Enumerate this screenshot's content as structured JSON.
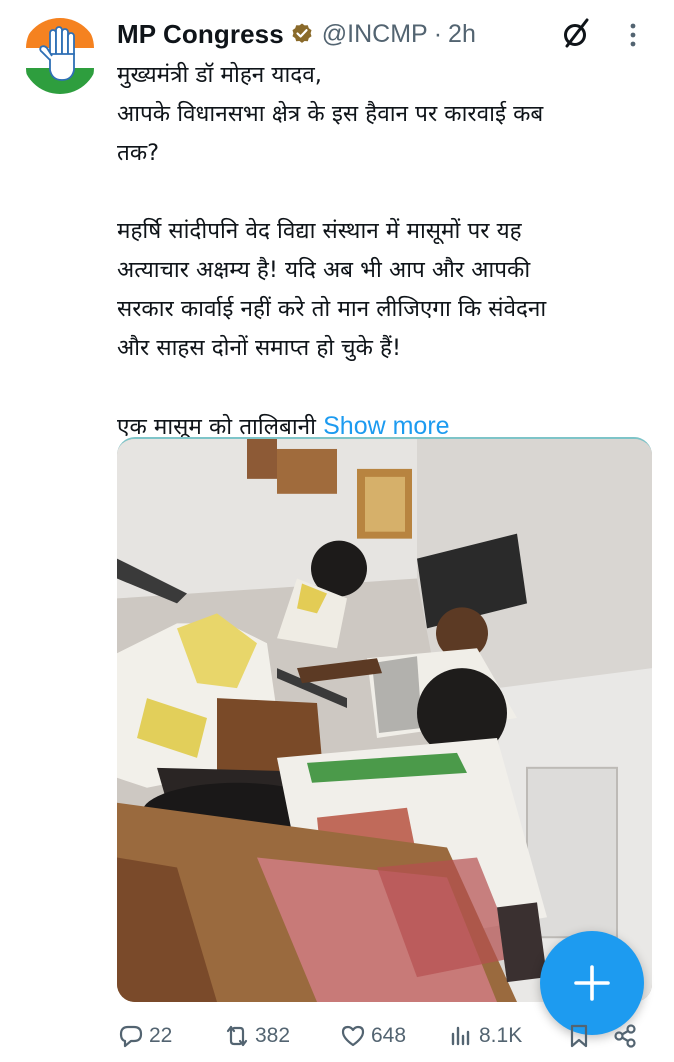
{
  "tweet": {
    "display_name": "MP Congress",
    "handle": "@INCMP",
    "separator": "·",
    "time": "2h",
    "body": {
      "line1": "मुख्यमंत्री डॉ मोहन यादव,",
      "line2": "आपके विधानसभा क्षेत्र के इस हैवान पर कारवाई कब",
      "line3": "तक?",
      "para2_line1": "महर्षि सांदीपनि वेद विद्या संस्थान में मासूमों पर यह",
      "para2_line2": "अत्याचार अक्षम्य है! यदि अब भी आप और आपकी",
      "para2_line3": "सरकार कार्वाई नहीं करे तो मान लीजिएगा कि संवेदना",
      "para2_line4": "और साहस दोनों समाप्त हो चुके हैं!",
      "para3": "एक मासूम को तालिबानी",
      "show_more": "Show more"
    },
    "stats": {
      "replies": "22",
      "reposts": "382",
      "likes": "648",
      "views": "8.1K"
    }
  },
  "colors": {
    "accent": "#1d9bf0",
    "secondary_text": "#536471",
    "primary_text": "#0f1419",
    "logo_saffron": "#f58220",
    "logo_green": "#2e9e3e"
  },
  "icons": {
    "avatar": "congress-hand-logo",
    "verified": "verified-badge-icon",
    "grok": "grok-icon",
    "more": "more-vertical-icon",
    "reply": "reply-icon",
    "repost": "repost-icon",
    "like": "heart-icon",
    "views": "views-icon",
    "bookmark": "bookmark-icon",
    "share": "share-icon",
    "compose": "plus-icon"
  }
}
